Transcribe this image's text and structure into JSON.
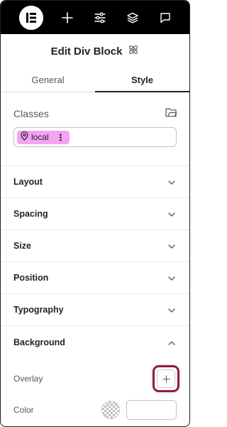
{
  "toolbar": {
    "logo_icon": "elementor-logo-icon",
    "buttons": [
      {
        "name": "add-element",
        "icon": "plus-icon"
      },
      {
        "name": "settings",
        "icon": "sliders-icon"
      },
      {
        "name": "structure",
        "icon": "layers-icon"
      },
      {
        "name": "notes",
        "icon": "comment-icon"
      }
    ]
  },
  "panel": {
    "title": "Edit Div Block",
    "title_icon": "atom-icon"
  },
  "tabs": [
    {
      "label": "General",
      "active": false
    },
    {
      "label": "Style",
      "active": true
    }
  ],
  "classes": {
    "label": "Classes",
    "chip_label": "local",
    "chip_color": "#f4a3f2",
    "chip_more": "⋮"
  },
  "sections": [
    {
      "label": "Layout",
      "expanded": false
    },
    {
      "label": "Spacing",
      "expanded": false
    },
    {
      "label": "Size",
      "expanded": false
    },
    {
      "label": "Position",
      "expanded": false
    },
    {
      "label": "Typography",
      "expanded": false
    },
    {
      "label": "Background",
      "expanded": true
    }
  ],
  "background": {
    "overlay_label": "Overlay",
    "color_label": "Color",
    "color_value": "",
    "highlight_color": "#8c1d48"
  }
}
